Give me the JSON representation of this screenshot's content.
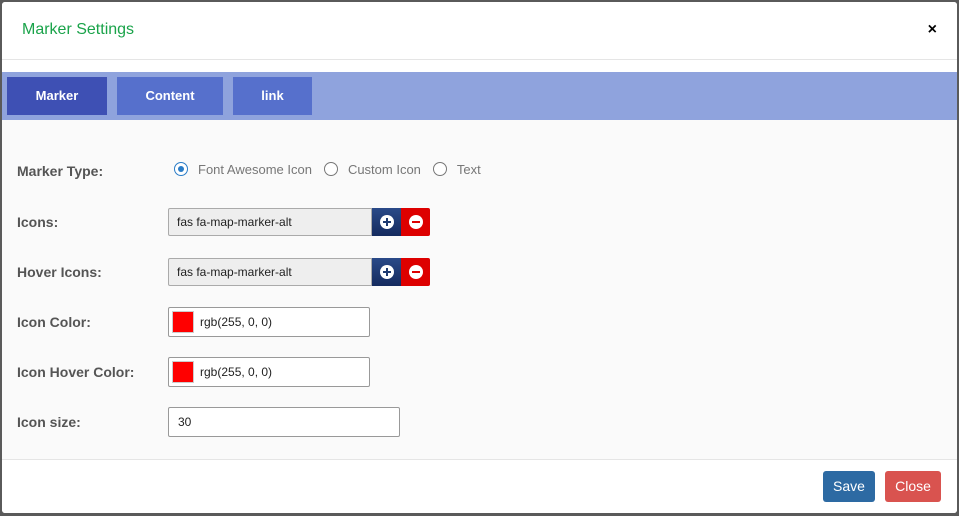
{
  "modal": {
    "title": "Marker Settings",
    "close_glyph": "×"
  },
  "tabs": [
    {
      "label": "Marker",
      "active": true
    },
    {
      "label": "Content",
      "active": false
    },
    {
      "label": "link",
      "active": false
    }
  ],
  "form": {
    "marker_type": {
      "label": "Marker Type:",
      "options": [
        "Font Awesome Icon",
        "Custom Icon",
        "Text"
      ],
      "selected": "Font Awesome Icon"
    },
    "icons": {
      "label": "Icons:",
      "value": "fas fa-map-marker-alt"
    },
    "hover_icons": {
      "label": "Hover Icons:",
      "value": "fas fa-map-marker-alt"
    },
    "icon_color": {
      "label": "Icon Color:",
      "value": "rgb(255, 0, 0)",
      "swatch": "#ff0000"
    },
    "icon_hover_color": {
      "label": "Icon Hover Color:",
      "value": "rgb(255, 0, 0)",
      "swatch": "#ff0000"
    },
    "icon_size": {
      "label": "Icon size:",
      "value": "30"
    }
  },
  "footer": {
    "save_label": "Save",
    "close_label": "Close"
  },
  "colors": {
    "title": "#1aa34a",
    "tab_bar": "#8fa3dd",
    "tab_active": "#3e50b4",
    "tab_inactive": "#5670cc",
    "add_button": "#1e3a70",
    "remove_button": "#dd0000",
    "save_button": "#2d6aa3",
    "close_button": "#d9534f"
  },
  "icons_used": [
    "plus-circle-icon",
    "minus-circle-icon",
    "close-icon"
  ]
}
